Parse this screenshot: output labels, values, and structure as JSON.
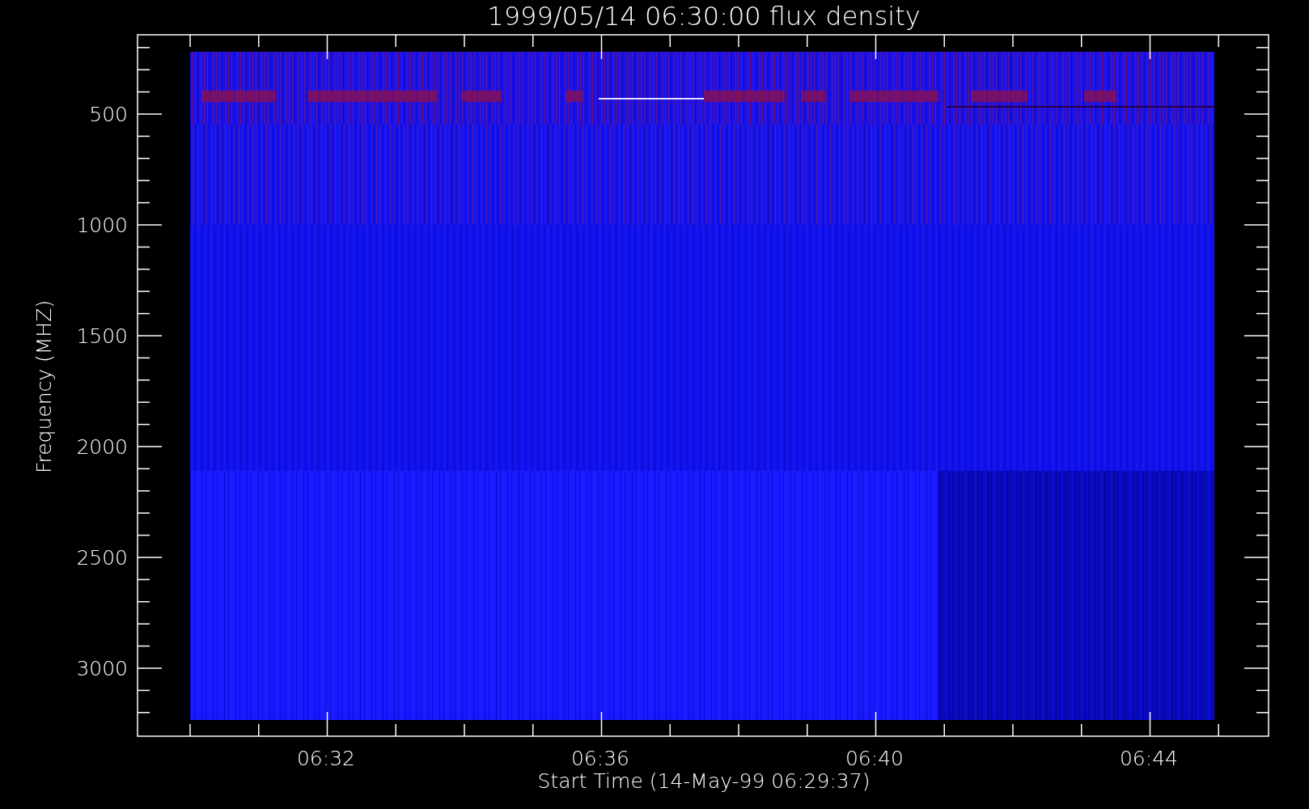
{
  "title": "1999/05/14 06:30:00 flux density",
  "y_axis": {
    "label": "Frequency (MHZ)",
    "tick_labels": [
      "500",
      "1000",
      "1500",
      "2000",
      "2500",
      "3000"
    ]
  },
  "x_axis": {
    "label": "Start Time (14-May-99 06:29:37)",
    "tick_labels": [
      "06:32",
      "06:36",
      "06:40",
      "06:44"
    ]
  }
}
